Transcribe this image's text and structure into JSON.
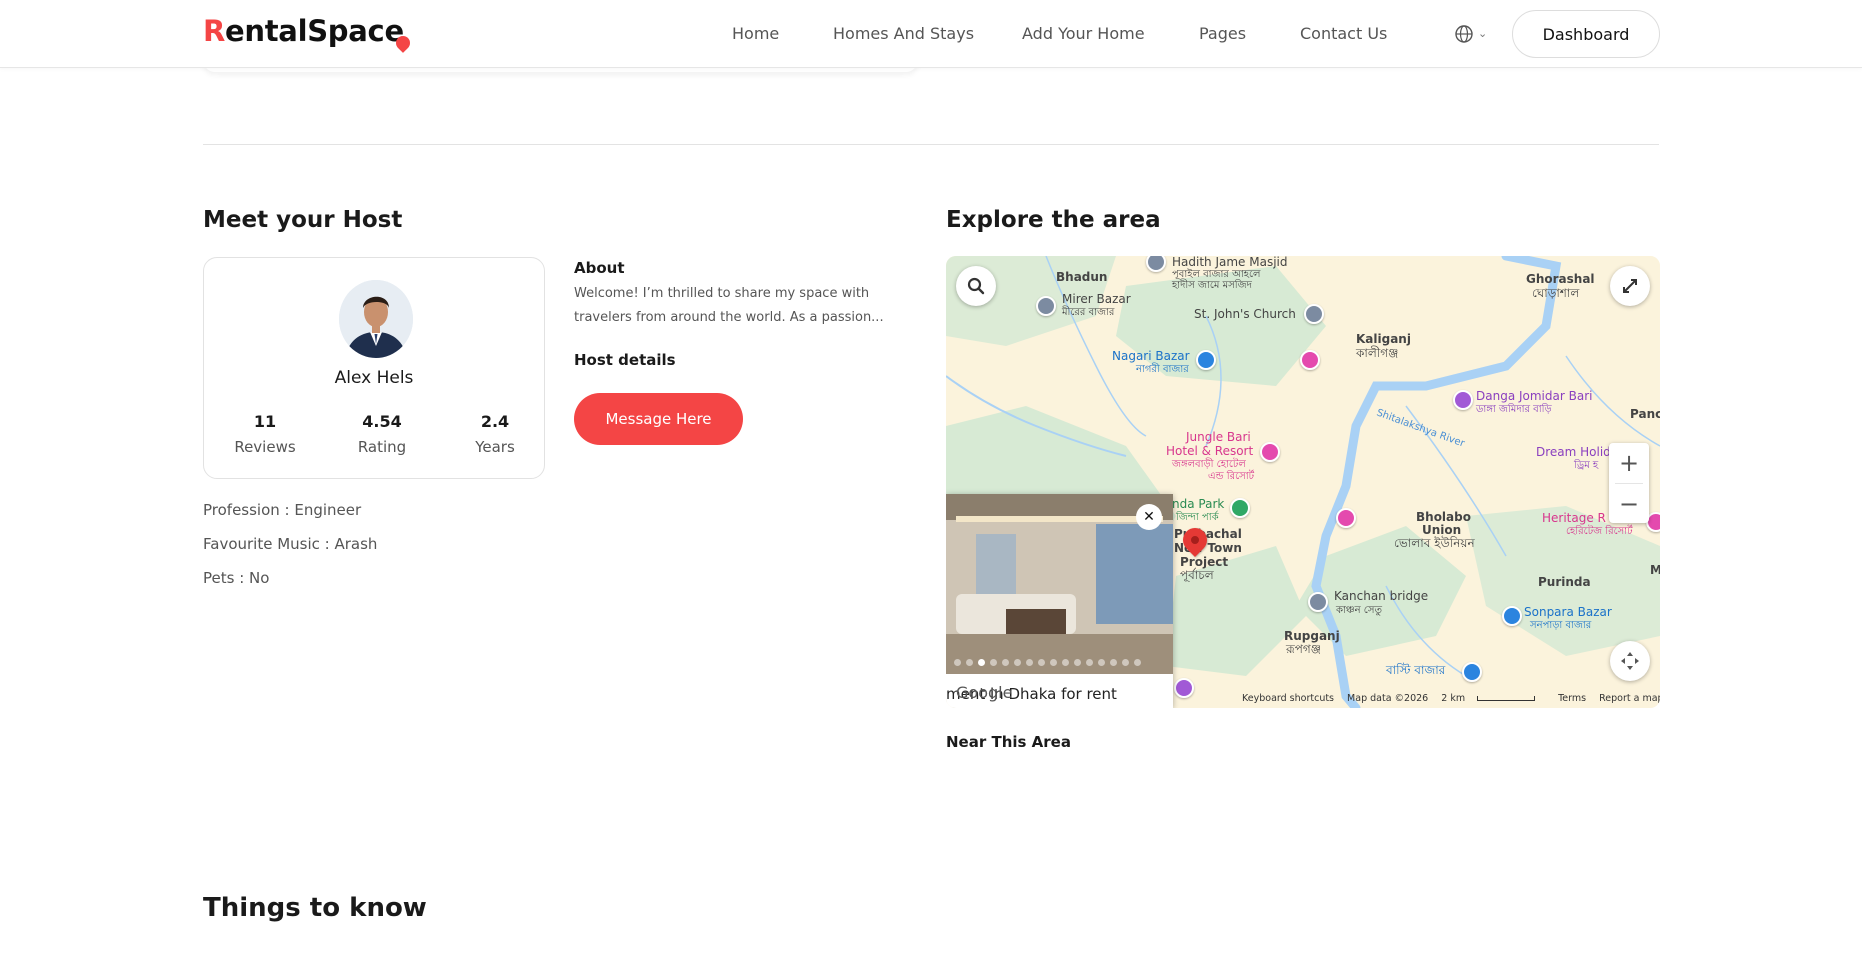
{
  "header": {
    "logo_first": "R",
    "logo_rest": "entalSpac",
    "logo_last": "e",
    "nav": [
      "Home",
      "Homes And Stays",
      "Add Your Home",
      "Pages",
      "Contact Us"
    ],
    "language_icon": "globe-icon",
    "dashboard_label": "Dashboard"
  },
  "host": {
    "title": "Meet your Host",
    "name": "Alex Hels",
    "stats": [
      {
        "value": "11",
        "label": "Reviews"
      },
      {
        "value": "4.54",
        "label": "Rating"
      },
      {
        "value": "2.4",
        "label": "Years"
      }
    ],
    "about_heading": "About",
    "about_text": "Welcome! I’m thrilled to share my space with travelers from around the world. As a passion...",
    "details_heading": "Host details",
    "message_button": "Message Here",
    "profession": "Profession : Engineer",
    "music": "Favourite Music : Arash",
    "pets": "Pets : No"
  },
  "explore": {
    "title": "Explore the area",
    "near_heading": "Near This Area",
    "map": {
      "labels": {
        "bhadun": "Bhadun",
        "mirer_bazar": "Mirer Bazar",
        "mirer_bazar_bn": "মীরের বাজার",
        "hadith": "Hadith Jame Masjid",
        "hadith_bn1": "পূবাইল বাজার আহলে",
        "hadith_bn2": "হাদীস জামে মসজিদ",
        "stjohns": "St. John's Church",
        "ghorashal": "Ghorashal",
        "ghorashal_bn": "ঘোড়াশাল",
        "kaliganj": "Kaliganj",
        "kaliganj_bn": "কালীগঞ্জ",
        "nagari": "Nagari Bazar",
        "nagari_bn": "নাগরী বাজার",
        "danga": "Danga Jomidar Bari",
        "danga_bn": "ডাঙ্গা জমিদার বাড়ি",
        "pand": "Panc",
        "shitalakshya": "Shitalakshya River",
        "jungle1": "Jungle Bari",
        "jungle2": "Hotel & Resort",
        "jungle_bn1": "জঙ্গলবাড়ী হোটেল",
        "jungle_bn2": "এন্ড রিসোর্ট",
        "dream": "Dream Holid",
        "dream_bn": "ড্রিম হ",
        "nanda": "nda Park",
        "nanda_bn": "জিন্দা পার্ক",
        "bholabo1": "Bholabo",
        "bholabo2": "Union",
        "bholabo_bn": "ভোলাব ইউনিয়ন",
        "heritage": "Heritage R",
        "heritage_bn": "হেরিটেজ রিসোর্ট",
        "purbachal1": "Purbachal",
        "purbachal2": "New Town",
        "purbachal3": "Project",
        "purbachal_bn": "পূর্বাচল",
        "purinda": "Purinda",
        "m": "M",
        "kanchan": "Kanchan bridge",
        "kanchan_bn": "কাঞ্চন সেতু",
        "sonpara": "Sonpara Bazar",
        "sonpara_bn": "সনপাড়া বাজার",
        "rupganj": "Rupganj",
        "rupganj_bn": "রূপগঞ্জ",
        "basti": "বাস্টি বাজার"
      },
      "popup_text": "ment in Dhaka for rent",
      "google": "Google",
      "footer": {
        "shortcuts": "Keyboard shortcuts",
        "data": "Map data ©2026",
        "scale": "2 km",
        "terms": "Terms",
        "report": "Report a map error"
      }
    }
  },
  "things": {
    "title": "Things to know"
  },
  "colors": {
    "accent": "#f44545",
    "map_land": "#fbf3dc",
    "map_green": "#d7ead4",
    "map_water": "#a9d1f5"
  }
}
